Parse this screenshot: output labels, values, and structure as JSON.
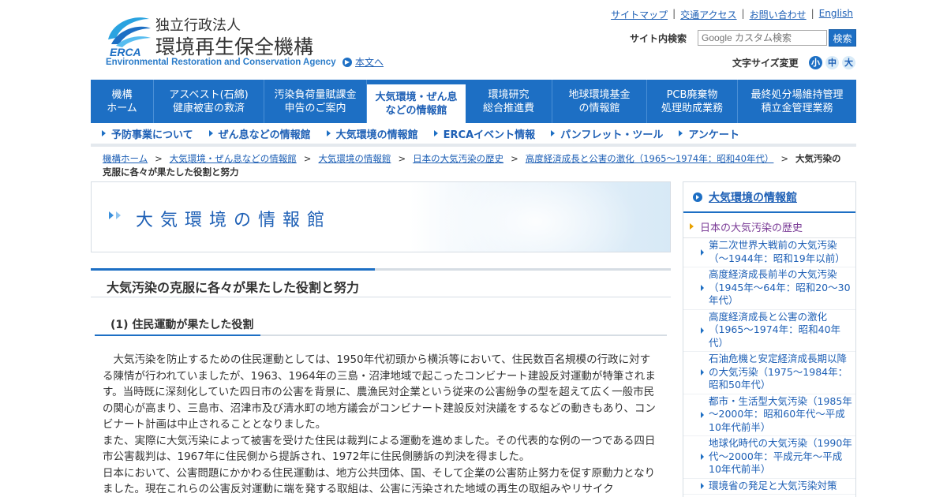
{
  "header": {
    "org_sub": "独立行政法人",
    "org_name": "環境再生保全機構",
    "org_en": "Environmental Restoration and Conservation Agency",
    "logo_text": "ERCA",
    "skip_link": "本文へ",
    "util_links": [
      "サイトマップ",
      "交通アクセス",
      "お問い合わせ",
      "English"
    ],
    "util_separator": "|",
    "search_label": "サイト内検索",
    "search_placeholder": "Google カスタム検索",
    "search_button": "検索",
    "fontsize_label": "文字サイズ変更",
    "fontsize_small": "小",
    "fontsize_medium": "中",
    "fontsize_large": "大"
  },
  "global_nav": [
    {
      "label": "機構\nホーム",
      "active": false
    },
    {
      "label": "アスベスト(石綿)\n健康被害の救済",
      "active": false
    },
    {
      "label": "汚染負荷量賦課金\n申告のご案内",
      "active": false
    },
    {
      "label": "大気環境・ぜん息\nなどの情報館",
      "active": true
    },
    {
      "label": "環境研究\n総合推進費",
      "active": false
    },
    {
      "label": "地球環境基金\nの情報館",
      "active": false
    },
    {
      "label": "PCB廃棄物\n処理助成業務",
      "active": false
    },
    {
      "label": "最終処分場維持管理\n積立金管理業務",
      "active": false
    }
  ],
  "sub_nav": [
    "予防事業について",
    "ぜん息などの情報館",
    "大気環境の情報館",
    "ERCAイベント情報",
    "パンフレット・ツール",
    "アンケート"
  ],
  "breadcrumb": {
    "items": [
      "機構ホーム",
      "大気環境・ぜん息などの情報館",
      "大気環境の情報館",
      "日本の大気汚染の歴史",
      "高度経済成長と公害の激化（1965～1974年：昭和40年代）"
    ],
    "separator": ">",
    "current": "大気汚染の克服に各々が果たした役割と努力"
  },
  "banner": {
    "title": "大気環境の情報館"
  },
  "main": {
    "page_heading": "大気汚染の克服に各々が果たした役割と努力",
    "section_heading": "(1) 住民運動が果たした役割",
    "paragraphs": [
      "　大気汚染を防止するための住民運動としては、1950年代初頭から横浜等において、住民数百名規模の行政に対する陳情が行われていましたが、1963、1964年の三島・沼津地域で起こったコンビナート建設反対運動が特筆されます。当時既に深刻化していた四日市の公害を背景に、農漁民対企業という従来の公害紛争の型を超えて広く一般市民の関心が高まり、三島市、沼津市及び清水町の地方議会がコンビナート建設反対決議をするなどの動きもあり、コンビナート計画は中止されることとなりました。",
      "また、実際に大気汚染によって被害を受けた住民は裁判による運動を進めました。その代表的な例の一つである四日市公害裁判は、1967年に住民側から提訴され、1972年に住民側勝訴の判決を得ました。",
      "日本において、公害問題にかかわる住民運動は、地方公共団体、国、そして企業の公害防止努力を促す原動力となりました。現在これらの公害反対運動に端を発する取組は、公害に汚染された地域の再生の取組みやリサイク"
    ]
  },
  "sidebar": {
    "title": "大気環境の情報館",
    "current_section": "日本の大気汚染の歴史",
    "items": [
      "第二次世界大戦前の大気汚染（～1944年：昭和19年以前）",
      "高度経済成長前半の大気汚染（1945年～64年：昭和20～30年代）",
      "高度経済成長と公害の激化（1965～1974年：昭和40年代）",
      "石油危機と安定経済成長期以降の大気汚染（1975～1984年：昭和50年代）",
      "都市・生活型大気汚染（1985年～2000年：昭和60年代～平成10年代前半）",
      "地球化時代の大気汚染（1990年代～2000年：平成元年～平成10年代前半）",
      "環境省の発足と大気汚染対策"
    ]
  },
  "colors": {
    "brand_blue": "#1d6fc4",
    "link_blue": "#1d5fb5",
    "current_purple": "#7a3b96",
    "orange_marker": "#e8a100"
  }
}
